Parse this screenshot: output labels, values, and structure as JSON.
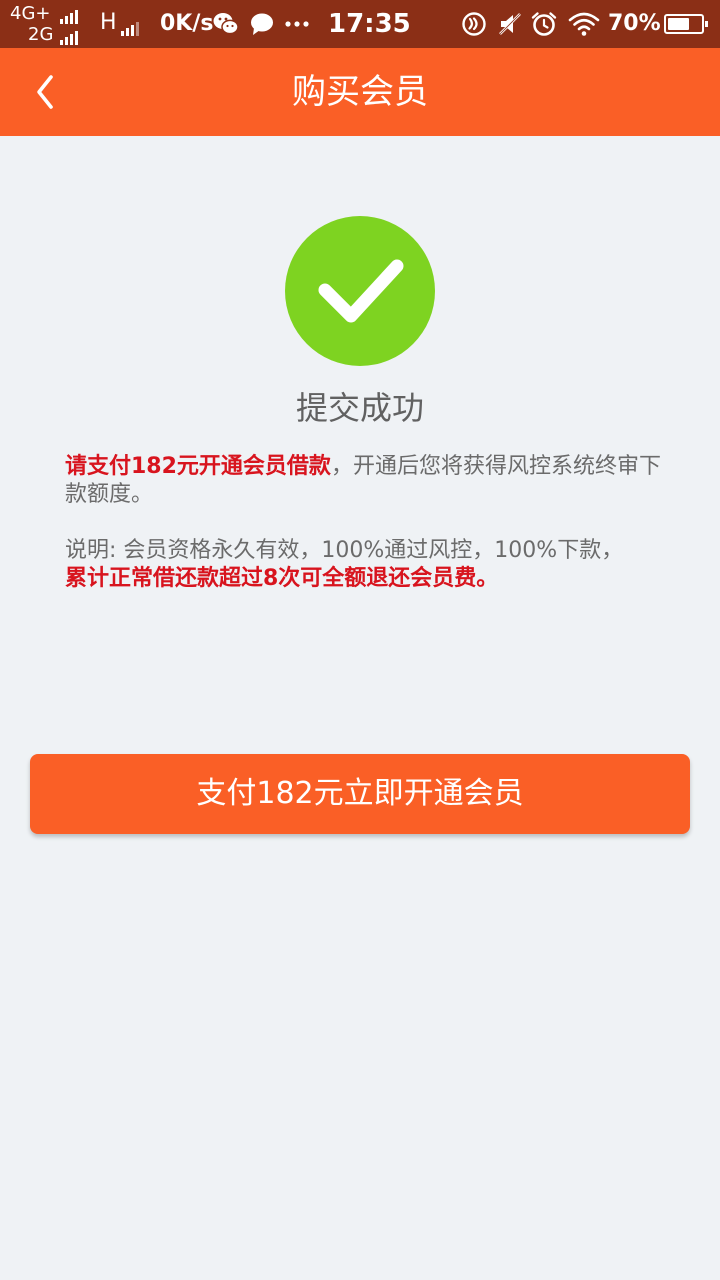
{
  "status_bar": {
    "network_top": "4G+",
    "network_bottom": "2G",
    "network_h": "H",
    "speed": "0K/s",
    "time": "17:35",
    "battery_pct": "70%",
    "battery_level": 0.7,
    "icons": [
      "wechat-icon",
      "message-bubble-icon",
      "more-dots-icon",
      "nfc-icon",
      "mute-icon",
      "alarm-icon",
      "wifi-icon",
      "battery-icon"
    ]
  },
  "header": {
    "title": "购买会员",
    "back_icon": "chevron-left-icon"
  },
  "colors": {
    "accent": "#FA5F26",
    "status_bar": "#8B2F16",
    "success": "#7ED321",
    "warning_text": "#D8141E",
    "body_text": "#6B6B6B",
    "background": "#EFF2F5"
  },
  "main": {
    "success_icon": "check-circle-icon",
    "success_text": "提交成功",
    "message1": {
      "highlight": "请支付182元开通会员借款",
      "rest": "，开通后您将获得风控系统终审下款额度。"
    },
    "message2": {
      "normal": "说明: 会员资格永久有效，100%通过风控，100%下款，",
      "highlight": "累计正常借还款超过8次可全额退还会员费。"
    },
    "pay_button_label": "支付182元立即开通会员"
  }
}
